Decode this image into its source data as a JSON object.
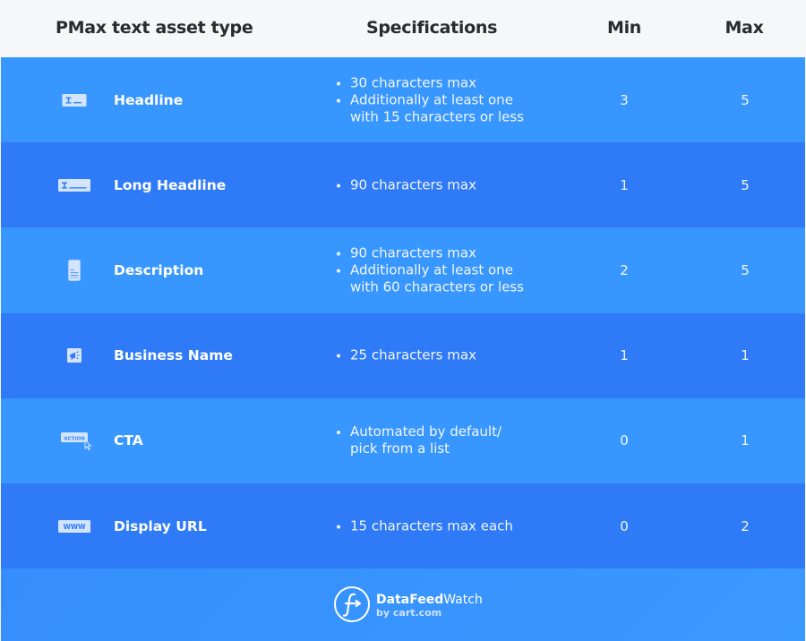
{
  "header": {
    "asset_type": "PMax text asset type",
    "specifications": "Specifications",
    "min": "Min",
    "max": "Max"
  },
  "colors": {
    "header_bg": "#f6f7f9",
    "header_text": "#2b2b2d",
    "row_light": "#3897fe",
    "row_dark": "#2f7af6",
    "text": "#ffffff"
  },
  "rows": [
    {
      "icon": "headline-text-field-icon",
      "name": "Headline",
      "specs": [
        [
          "30 characters max"
        ],
        [
          "Additionally at least one",
          "with 15 characters or less"
        ]
      ],
      "min": "3",
      "max": "5"
    },
    {
      "icon": "long-headline-text-field-icon",
      "name": "Long Headline",
      "specs": [
        [
          "90 characters max"
        ]
      ],
      "min": "1",
      "max": "5"
    },
    {
      "icon": "document-icon",
      "name": "Description",
      "specs": [
        [
          "90 characters max"
        ],
        [
          "Additionally at least one",
          "with 60 characters or less"
        ]
      ],
      "min": "2",
      "max": "5"
    },
    {
      "icon": "megaphone-icon",
      "name": "Business Name",
      "specs": [
        [
          "25 characters max"
        ]
      ],
      "min": "1",
      "max": "1"
    },
    {
      "icon": "action-button-cursor-icon",
      "icon_label": "ACTION",
      "name": "CTA",
      "specs": [
        [
          "Automated by default/",
          "pick from a list"
        ]
      ],
      "min": "0",
      "max": "1"
    },
    {
      "icon": "www-url-icon",
      "icon_label": "WWW",
      "name": "Display URL",
      "specs": [
        [
          "15 characters max each"
        ]
      ],
      "min": "0",
      "max": "2"
    }
  ],
  "footer": {
    "logo_icon": "datafeedwatch-logo-icon",
    "brand_bold": "DataFeed",
    "brand_regular": "Watch",
    "brand_sub": "by cart.com"
  }
}
